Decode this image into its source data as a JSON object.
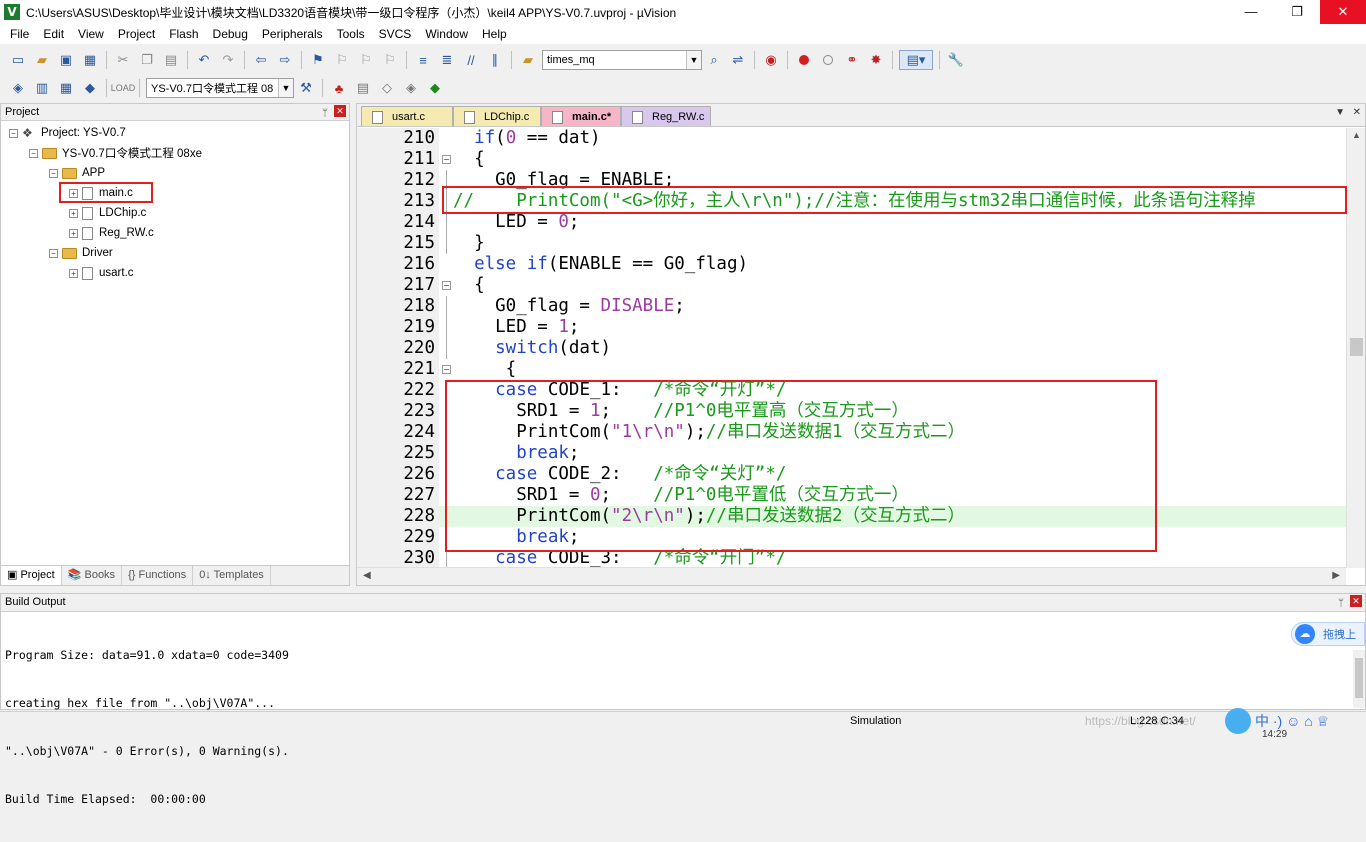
{
  "window": {
    "title": "C:\\Users\\ASUS\\Desktop\\毕业设计\\模块文档\\LD3320语音模块\\带一级口令程序（小杰）\\keil4 APP\\YS-V0.7.uvproj - µVision",
    "app_icon": "V",
    "minimize": "—",
    "maximize": "❐",
    "close": "✕"
  },
  "menu": [
    "File",
    "Edit",
    "View",
    "Project",
    "Flash",
    "Debug",
    "Peripherals",
    "Tools",
    "SVCS",
    "Window",
    "Help"
  ],
  "toolbar": {
    "find_value": "times_mq",
    "target_value": "YS-V0.7口令模式工程 08"
  },
  "project_panel": {
    "title": "Project",
    "pin": "ᛘ",
    "close": "✕",
    "tree": {
      "root": "Project: YS-V0.7",
      "target": "YS-V0.7口令模式工程 08xe",
      "group_app": "APP",
      "files_app": [
        "main.c",
        "LDChip.c",
        "Reg_RW.c"
      ],
      "group_driver": "Driver",
      "files_driver": [
        "usart.c"
      ]
    },
    "tabs": [
      "Project",
      "Books",
      "Functions",
      "Templates"
    ],
    "tab_icons": [
      "▣",
      "📚",
      "{}",
      "0↓"
    ]
  },
  "editor": {
    "tabs": [
      "usart.c",
      "LDChip.c",
      "main.c*",
      "Reg_RW.c"
    ],
    "active_tab": "main.c*",
    "tab_colors": [
      "#f5eab2",
      "#f5eab2",
      "#f7b5c8",
      "#d8c8ee"
    ],
    "tab_dropdown": "▼",
    "tab_close": "✕",
    "lines": [
      {
        "n": "210",
        "fold": "",
        "text": [
          [
            "kw",
            "  if"
          ],
          [
            "",
            "("
          ],
          [
            "num",
            "0"
          ],
          [
            "",
            " == dat)"
          ]
        ]
      },
      {
        "n": "211",
        "fold": "−",
        "text": [
          [
            "",
            "  {"
          ]
        ]
      },
      {
        "n": "212",
        "fold": "|",
        "text": [
          [
            "",
            "    G0_flag = ENABLE;"
          ]
        ]
      },
      {
        "n": "213",
        "fold": "|",
        "text": [
          [
            "cm",
            "//    PrintCom(\"<G>你好，主人\\r\\n\");//注意：在使用与stm32串口通信时候，此条语句注释掉"
          ]
        ]
      },
      {
        "n": "214",
        "fold": "|",
        "text": [
          [
            "",
            "    LED = "
          ],
          [
            "num",
            "0"
          ],
          [
            "",
            ";"
          ]
        ]
      },
      {
        "n": "215",
        "fold": "|",
        "text": [
          [
            "",
            "  }"
          ]
        ]
      },
      {
        "n": "216",
        "fold": "",
        "text": [
          [
            "kw",
            "  else if"
          ],
          [
            "",
            "(ENABLE == G0_flag)"
          ]
        ]
      },
      {
        "n": "217",
        "fold": "−",
        "text": [
          [
            "",
            "  {"
          ]
        ]
      },
      {
        "n": "218",
        "fold": "|",
        "text": [
          [
            "",
            "    G0_flag = "
          ],
          [
            "mac",
            "DISABLE"
          ],
          [
            "",
            ";"
          ]
        ]
      },
      {
        "n": "219",
        "fold": "|",
        "text": [
          [
            "",
            "    LED = "
          ],
          [
            "num",
            "1"
          ],
          [
            "",
            ";"
          ]
        ]
      },
      {
        "n": "220",
        "fold": "|",
        "text": [
          [
            "kw",
            "    switch"
          ],
          [
            "",
            "(dat)"
          ]
        ]
      },
      {
        "n": "221",
        "fold": "−",
        "text": [
          [
            "",
            "     {"
          ]
        ]
      },
      {
        "n": "222",
        "fold": "|",
        "text": [
          [
            "kw",
            "    case"
          ],
          [
            "",
            " CODE_1:   "
          ],
          [
            "cm",
            "/*命令“开灯”*/"
          ]
        ]
      },
      {
        "n": "223",
        "fold": "|",
        "text": [
          [
            "",
            "      SRD1 = "
          ],
          [
            "num",
            "1"
          ],
          [
            "",
            ";    "
          ],
          [
            "cm",
            "//P1^0电平置高（交互方式一）"
          ]
        ]
      },
      {
        "n": "224",
        "fold": "|",
        "text": [
          [
            "",
            "      PrintCom("
          ],
          [
            "str",
            "\"1\\r\\n\""
          ],
          [
            "",
            ");"
          ],
          [
            "cm",
            "//串口发送数据1（交互方式二）"
          ]
        ]
      },
      {
        "n": "225",
        "fold": "|",
        "text": [
          [
            "kw",
            "      break"
          ],
          [
            "",
            ";"
          ]
        ]
      },
      {
        "n": "226",
        "fold": "|",
        "text": [
          [
            "kw",
            "    case"
          ],
          [
            "",
            " CODE_2:   "
          ],
          [
            "cm",
            "/*命令“关灯”*/"
          ]
        ]
      },
      {
        "n": "227",
        "fold": "|",
        "text": [
          [
            "",
            "      SRD1 = "
          ],
          [
            "num",
            "0"
          ],
          [
            "",
            ";    "
          ],
          [
            "cm",
            "//P1^0电平置低（交互方式一）"
          ]
        ]
      },
      {
        "n": "228",
        "fold": "|",
        "text": [
          [
            "",
            "      PrintCom("
          ],
          [
            "str",
            "\"2\\r\\n\""
          ],
          [
            "",
            ");"
          ],
          [
            "cm",
            "//串口发送数据2（交互方式二）"
          ]
        ]
      },
      {
        "n": "229",
        "fold": "|",
        "text": [
          [
            "kw",
            "      break"
          ],
          [
            "",
            ";"
          ]
        ]
      },
      {
        "n": "230",
        "fold": "|",
        "text": [
          [
            "kw",
            "    case"
          ],
          [
            "",
            " CODE_3:   "
          ],
          [
            "cm",
            "/*命令“开门”*/"
          ]
        ]
      }
    ],
    "highlighted_line": "228"
  },
  "build_output": {
    "title": "Build Output",
    "pin": "ᛘ",
    "close": "✕",
    "lines": [
      "Program Size: data=91.0 xdata=0 code=3409",
      "creating hex file from \"..\\obj\\V07A\"...",
      "\"..\\obj\\V07A\" - 0 Error(s), 0 Warning(s).",
      "Build Time Elapsed:  00:00:00"
    ],
    "float_button_label": "拖拽上",
    "float_button_icon": "☁"
  },
  "statusbar": {
    "mode": "Simulation",
    "position": "L:228 C:34",
    "watermark": "https://blog.csdn.net/",
    "ime_label": "中 ·) ☺ ⌂ ♕",
    "clock": "14:29"
  },
  "colors": {
    "highlight_line": "#e3f8e3",
    "keyword": "#2044c8",
    "comment": "#1a9a1a",
    "number": "#9b3ca0",
    "annotation_box": "#e02020"
  }
}
